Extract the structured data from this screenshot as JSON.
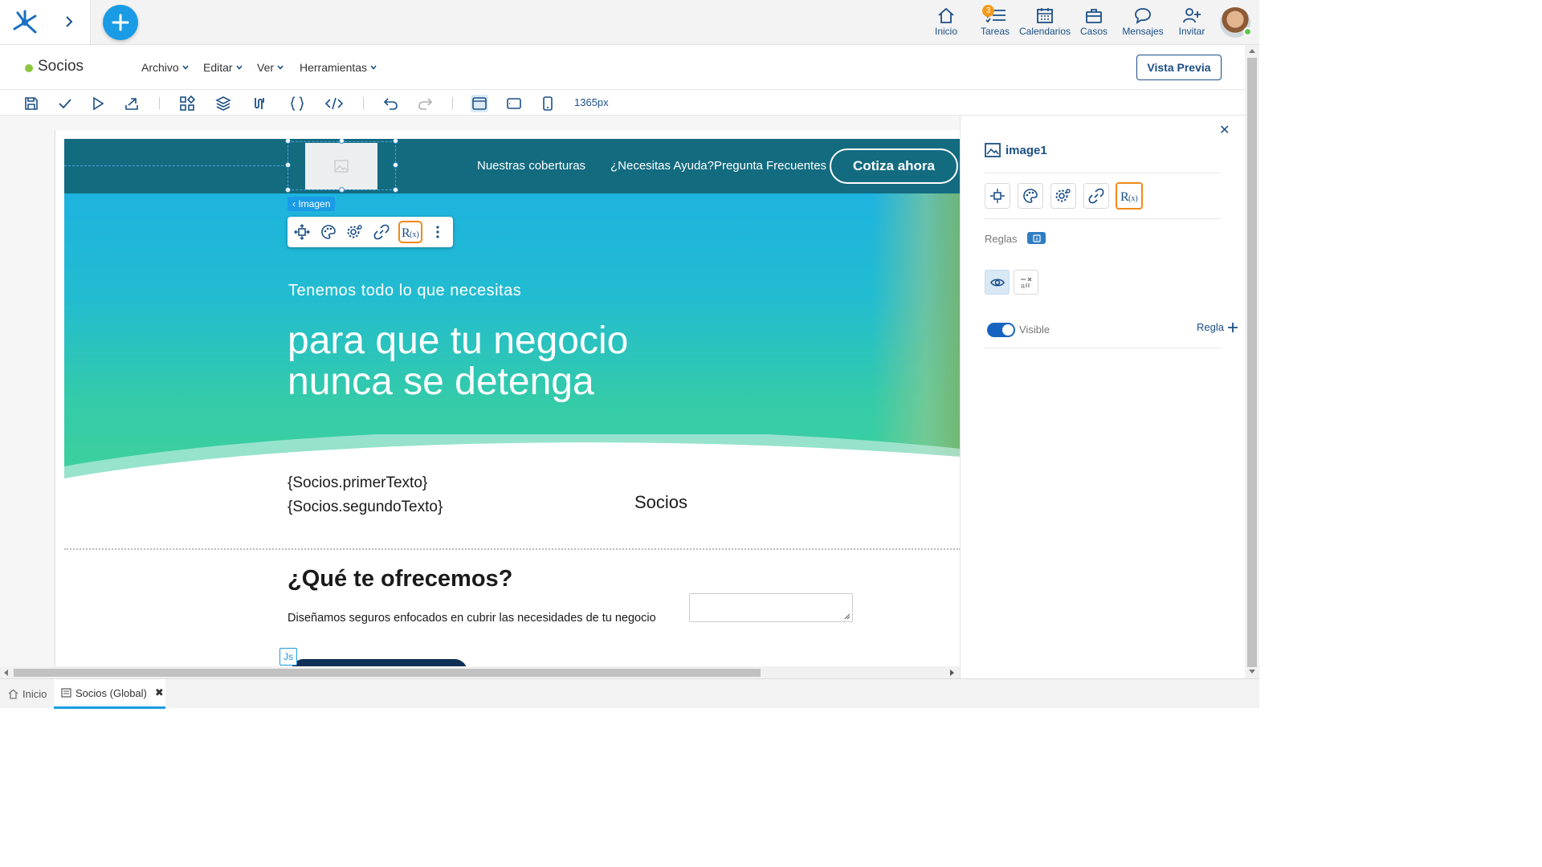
{
  "topbar": {
    "nav": [
      {
        "id": "inicio",
        "label": "Inicio",
        "icon": "home-icon"
      },
      {
        "id": "tareas",
        "label": "Tareas",
        "icon": "tasks-icon",
        "badge": "3"
      },
      {
        "id": "calendarios",
        "label": "Calendarios",
        "icon": "calendar-icon"
      },
      {
        "id": "casos",
        "label": "Casos",
        "icon": "briefcase-icon"
      },
      {
        "id": "mensajes",
        "label": "Mensajes",
        "icon": "chat-icon"
      },
      {
        "id": "invitar",
        "label": "Invitar",
        "icon": "add-user-icon"
      }
    ]
  },
  "document": {
    "title": "Socios",
    "menu": [
      "Archivo",
      "Editar",
      "Ver",
      "Herramientas"
    ],
    "preview_label": "Vista Previa"
  },
  "toolbar": {
    "width_label": "1365px"
  },
  "canvas": {
    "nav_links": [
      "Nuestras coberturas",
      "¿Necesitas Ayuda?Pregunta Frecuentes"
    ],
    "cta_label": "Cotiza ahora",
    "selected_label": "Imagen",
    "hero_subtitle": "Tenemos todo lo que necesitas",
    "hero_title": "para que tu negocio nunca se detenga",
    "text1": "{Socios.primerTexto}",
    "text2": "{Socios.segundoTexto}",
    "right_text": "Socios",
    "offer_title": "¿Qué te ofrecemos?",
    "offer_desc": "Diseñamos seguros enfocados en cubrir las necesidades de tu negocio",
    "js_tag": "Js"
  },
  "panel": {
    "element_name": "image1",
    "rules_label": "Reglas",
    "visible_label": "Visible",
    "visible_on": true,
    "add_rule_label": "Regla"
  },
  "bottom_tabs": [
    {
      "label": "Inicio",
      "active": false
    },
    {
      "label": "Socios (Global)",
      "active": true
    }
  ],
  "colors": {
    "accent": "#1a9be6",
    "primary_dark": "#1b4f86",
    "hero_nav": "#136b80",
    "highlight": "#f0891a"
  }
}
